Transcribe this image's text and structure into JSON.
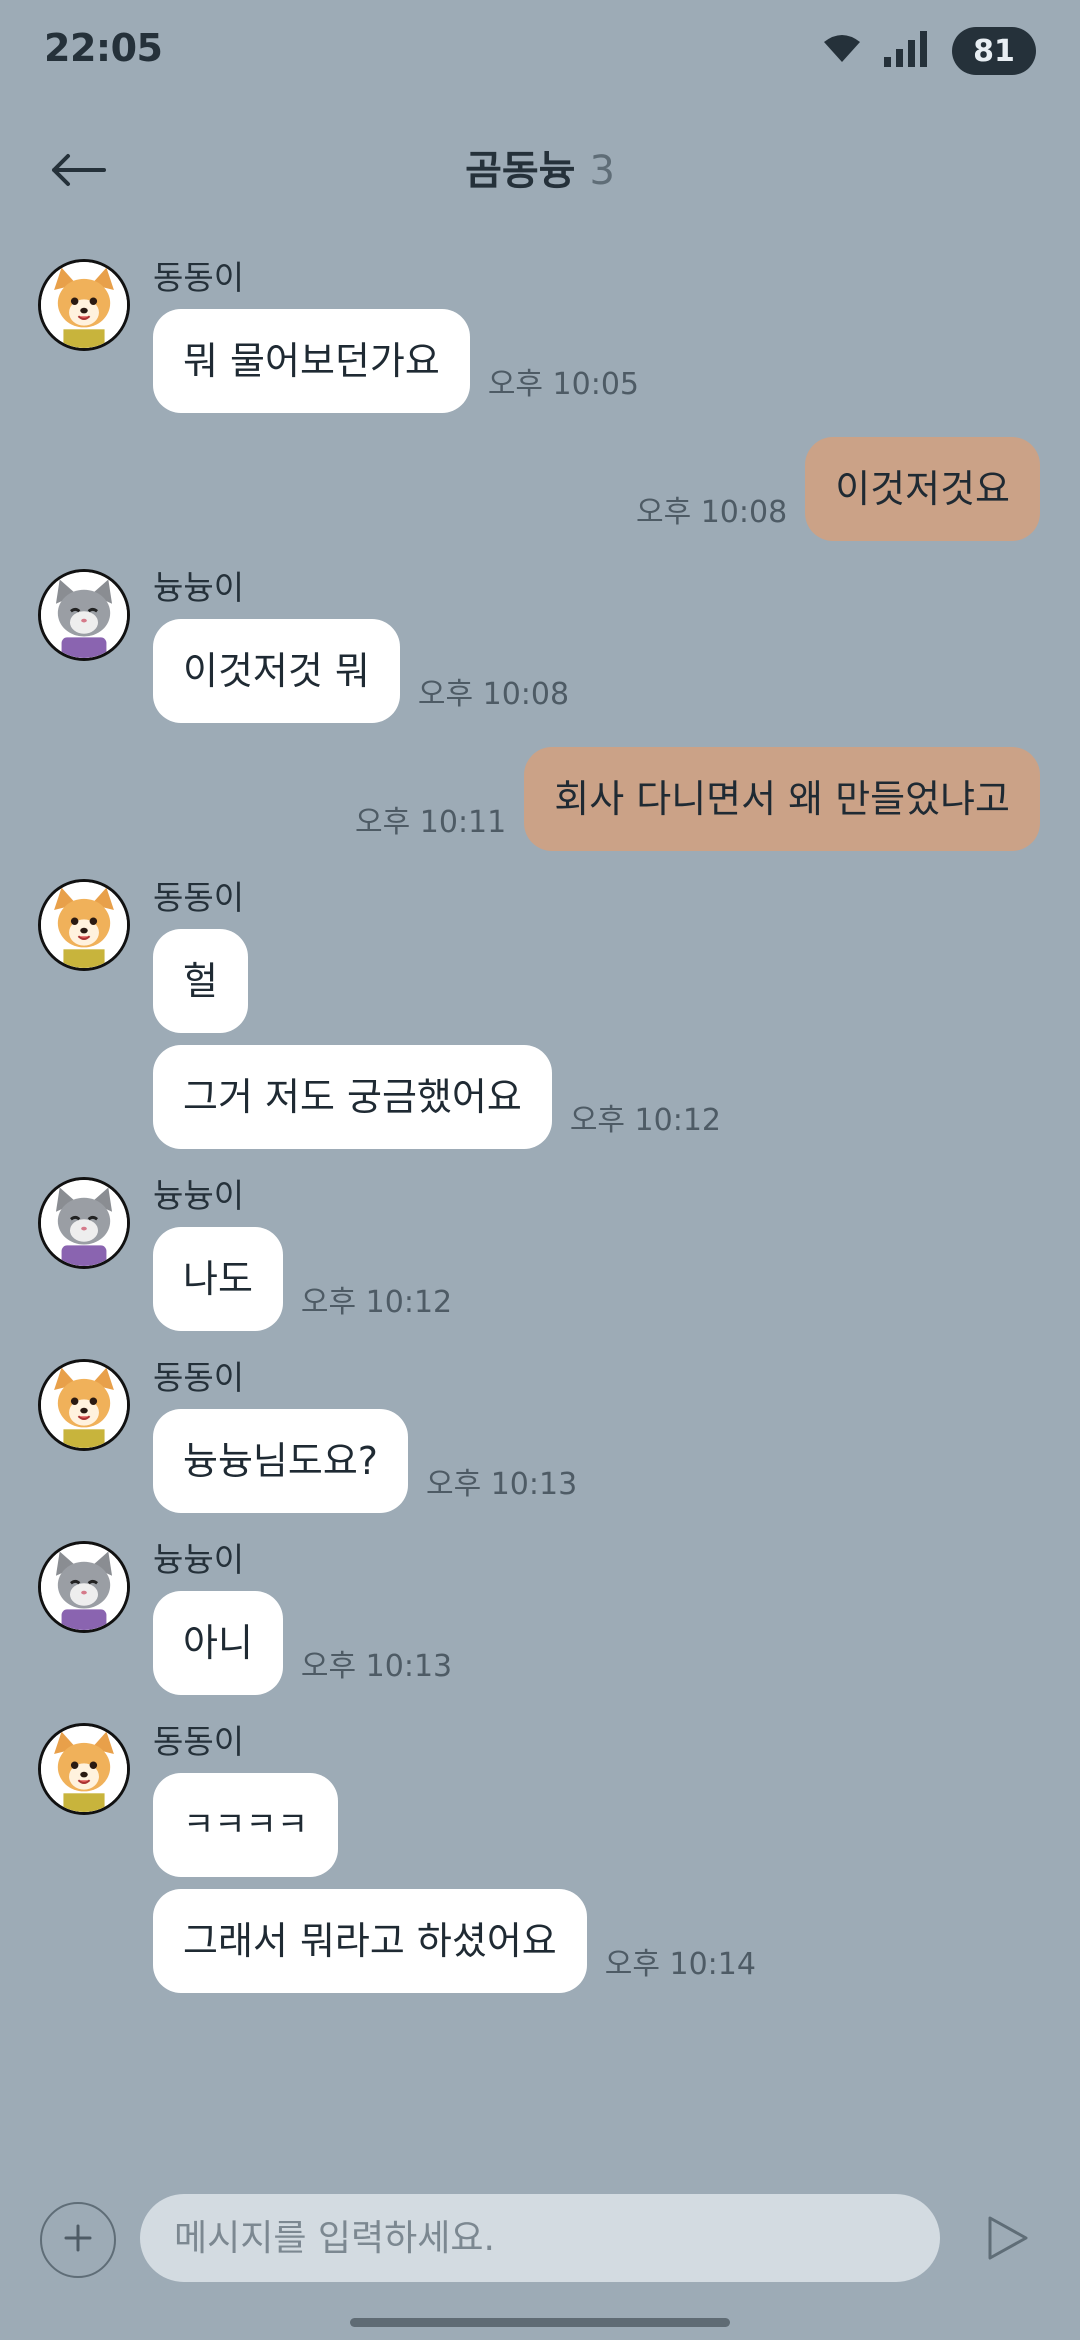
{
  "status_bar": {
    "time": "22:05",
    "battery": "81",
    "icons": [
      "wifi-icon",
      "signal-icon"
    ]
  },
  "header": {
    "title": "곰동늉",
    "member_count": "3",
    "back_icon": "arrow-left-icon"
  },
  "colors": {
    "background": "#9dabb6",
    "bubble_incoming": "#ffffff",
    "bubble_outgoing": "#cba287",
    "input_background": "#d3dbe1"
  },
  "messages": [
    {
      "sender": "동동이",
      "avatar": "dog-avatar",
      "bubbles": [
        "뭐 물어보던가요"
      ],
      "time": "오후 10:05"
    },
    {
      "mine": true,
      "text": "이것저것요",
      "time": "오후 10:08"
    },
    {
      "sender": "늉늉이",
      "avatar": "cat-avatar",
      "bubbles": [
        "이것저것 뭐"
      ],
      "time": "오후 10:08"
    },
    {
      "mine": true,
      "text": "회사 다니면서 왜 만들었냐고",
      "time": "오후 10:11"
    },
    {
      "sender": "동동이",
      "avatar": "dog-avatar",
      "bubbles": [
        "헐",
        "그거 저도 궁금했어요"
      ],
      "time": "오후 10:12"
    },
    {
      "sender": "늉늉이",
      "avatar": "cat-avatar",
      "bubbles": [
        "나도"
      ],
      "time": "오후 10:12"
    },
    {
      "sender": "동동이",
      "avatar": "dog-avatar",
      "bubbles": [
        "늉늉님도요?"
      ],
      "time": "오후 10:13"
    },
    {
      "sender": "늉늉이",
      "avatar": "cat-avatar",
      "bubbles": [
        "아니"
      ],
      "time": "오후 10:13"
    },
    {
      "sender": "동동이",
      "avatar": "dog-avatar",
      "bubbles": [
        "ㅋㅋㅋㅋ",
        "그래서 뭐라고 하셨어요"
      ],
      "time": "오후 10:14"
    }
  ],
  "input": {
    "placeholder": "메시지를 입력하세요.",
    "value": "",
    "plus_icon": "plus-icon",
    "send_icon": "send-icon"
  }
}
